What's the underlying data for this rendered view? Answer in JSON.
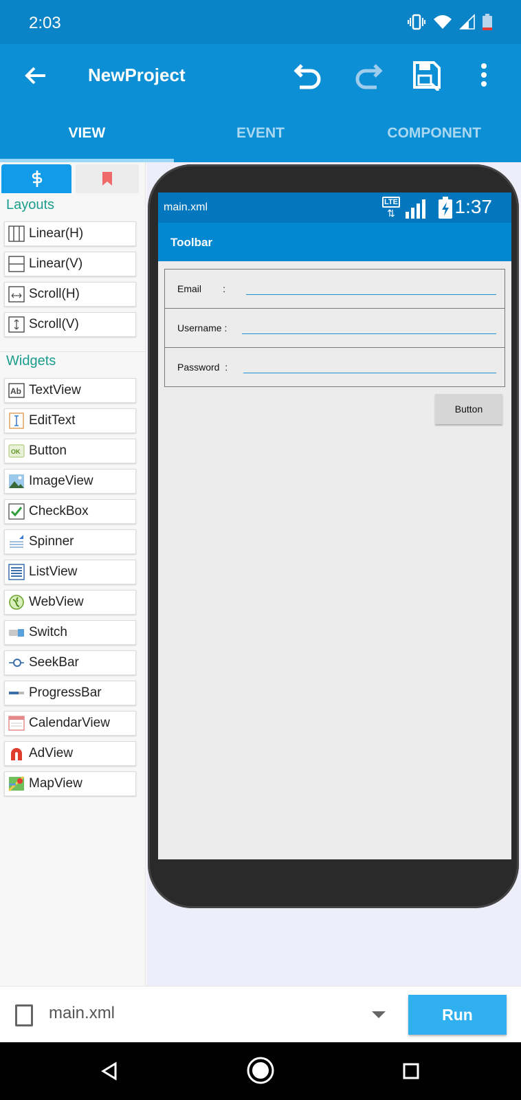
{
  "status_bar": {
    "time": "2:03"
  },
  "app_bar": {
    "title": "NewProject"
  },
  "tabs": [
    {
      "label": "VIEW",
      "active": true
    },
    {
      "label": "EVENT",
      "active": false
    },
    {
      "label": "COMPONENT",
      "active": false
    }
  ],
  "palette": {
    "layouts_title": "Layouts",
    "layouts": [
      {
        "label": "Linear(H)",
        "icon": "linear-horizontal-icon"
      },
      {
        "label": "Linear(V)",
        "icon": "linear-vertical-icon"
      },
      {
        "label": "Scroll(H)",
        "icon": "scroll-horizontal-icon"
      },
      {
        "label": "Scroll(V)",
        "icon": "scroll-vertical-icon"
      }
    ],
    "widgets_title": "Widgets",
    "widgets": [
      {
        "label": "TextView",
        "icon": "textview-icon"
      },
      {
        "label": "EditText",
        "icon": "edittext-icon"
      },
      {
        "label": "Button",
        "icon": "button-icon"
      },
      {
        "label": "ImageView",
        "icon": "imageview-icon"
      },
      {
        "label": "CheckBox",
        "icon": "checkbox-icon"
      },
      {
        "label": "Spinner",
        "icon": "spinner-icon"
      },
      {
        "label": "ListView",
        "icon": "listview-icon"
      },
      {
        "label": "WebView",
        "icon": "webview-icon"
      },
      {
        "label": "Switch",
        "icon": "switch-icon"
      },
      {
        "label": "SeekBar",
        "icon": "seekbar-icon"
      },
      {
        "label": "ProgressBar",
        "icon": "progressbar-icon"
      },
      {
        "label": "CalendarView",
        "icon": "calendarview-icon"
      },
      {
        "label": "AdView",
        "icon": "adview-icon"
      },
      {
        "label": "MapView",
        "icon": "mapview-icon"
      }
    ]
  },
  "preview": {
    "file_name": "main.xml",
    "status_icons": {
      "lte": "LTE"
    },
    "time": "1:37",
    "toolbar_title": "Toolbar",
    "fields": [
      {
        "label": "Email        :"
      },
      {
        "label": "Username :"
      },
      {
        "label": "Password  :"
      }
    ],
    "button_label": "Button"
  },
  "bottom_bar": {
    "file_name": "main.xml",
    "run_label": "Run"
  },
  "colors": {
    "primary": "#0d8fd6",
    "status": "#0a84c6",
    "accent": "#31b0ef",
    "section": "#1a9c8c"
  }
}
